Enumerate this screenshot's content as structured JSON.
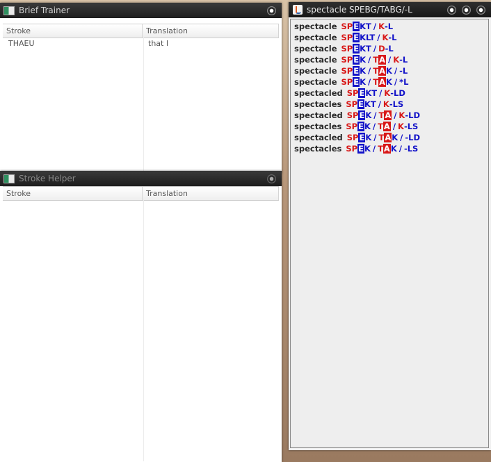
{
  "brief_trainer": {
    "title": "Brief Trainer",
    "columns": [
      "Stroke",
      "Translation"
    ],
    "rows": [
      {
        "stroke": "THAEU",
        "translation": "that I"
      }
    ]
  },
  "stroke_helper": {
    "title": "Stroke Helper",
    "columns": [
      "Stroke",
      "Translation"
    ],
    "rows": []
  },
  "spectacle_window": {
    "title": "spectacle  SPEBG/TABG/-L",
    "lines": [
      {
        "word": "spectacle",
        "segments": [
          [
            "red",
            "SP"
          ],
          [
            "hl-blue",
            "E"
          ],
          [
            "blue",
            "KT"
          ],
          [
            "sep",
            "/"
          ],
          [
            "red",
            "K"
          ],
          [
            "blue",
            "-L"
          ]
        ]
      },
      {
        "word": "spectacle",
        "segments": [
          [
            "red",
            "SP"
          ],
          [
            "hl-blue",
            "E"
          ],
          [
            "blue",
            "KLT"
          ],
          [
            "sep",
            "/"
          ],
          [
            "red",
            "K"
          ],
          [
            "blue",
            "-L"
          ]
        ]
      },
      {
        "word": "spectacle",
        "segments": [
          [
            "red",
            "SP"
          ],
          [
            "hl-blue",
            "E"
          ],
          [
            "blue",
            "KT"
          ],
          [
            "sep",
            "/"
          ],
          [
            "red",
            "D"
          ],
          [
            "blue",
            "-L"
          ]
        ]
      },
      {
        "word": "spectacle",
        "segments": [
          [
            "red",
            "SP"
          ],
          [
            "hl-blue",
            "E"
          ],
          [
            "blue",
            "K"
          ],
          [
            "sep",
            "/"
          ],
          [
            "red",
            "T"
          ],
          [
            "hl-red",
            "A"
          ],
          [
            "sep",
            "/"
          ],
          [
            "red",
            "K"
          ],
          [
            "blue",
            "-L"
          ]
        ]
      },
      {
        "word": "spectacle",
        "segments": [
          [
            "red",
            "SP"
          ],
          [
            "hl-blue",
            "E"
          ],
          [
            "blue",
            "K"
          ],
          [
            "sep",
            "/"
          ],
          [
            "red",
            "T"
          ],
          [
            "hl-red",
            "A"
          ],
          [
            "blue",
            "K"
          ],
          [
            "sep",
            "/"
          ],
          [
            "blue",
            "-L"
          ]
        ]
      },
      {
        "word": "spectacle",
        "segments": [
          [
            "red",
            "SP"
          ],
          [
            "hl-blue",
            "E"
          ],
          [
            "blue",
            "K"
          ],
          [
            "sep",
            "/"
          ],
          [
            "red",
            "T"
          ],
          [
            "hl-red",
            "A"
          ],
          [
            "blue",
            "K"
          ],
          [
            "sep",
            "/"
          ],
          [
            "blue",
            "*L"
          ]
        ]
      },
      {
        "word": "spectacled",
        "segments": [
          [
            "red",
            "SP"
          ],
          [
            "hl-blue",
            "E"
          ],
          [
            "blue",
            "KT"
          ],
          [
            "sep",
            "/"
          ],
          [
            "red",
            "K"
          ],
          [
            "blue",
            "-LD"
          ]
        ]
      },
      {
        "word": "spectacles",
        "segments": [
          [
            "red",
            "SP"
          ],
          [
            "hl-blue",
            "E"
          ],
          [
            "blue",
            "KT"
          ],
          [
            "sep",
            "/"
          ],
          [
            "red",
            "K"
          ],
          [
            "blue",
            "-LS"
          ]
        ]
      },
      {
        "word": "spectacled",
        "segments": [
          [
            "red",
            "SP"
          ],
          [
            "hl-blue",
            "E"
          ],
          [
            "blue",
            "K"
          ],
          [
            "sep",
            "/"
          ],
          [
            "red",
            "T"
          ],
          [
            "hl-red",
            "A"
          ],
          [
            "sep",
            "/"
          ],
          [
            "red",
            "K"
          ],
          [
            "blue",
            "-LD"
          ]
        ]
      },
      {
        "word": "spectacles",
        "segments": [
          [
            "red",
            "SP"
          ],
          [
            "hl-blue",
            "E"
          ],
          [
            "blue",
            "K"
          ],
          [
            "sep",
            "/"
          ],
          [
            "red",
            "T"
          ],
          [
            "hl-red",
            "A"
          ],
          [
            "sep",
            "/"
          ],
          [
            "red",
            "K"
          ],
          [
            "blue",
            "-LS"
          ]
        ]
      },
      {
        "word": "spectacled",
        "segments": [
          [
            "red",
            "SP"
          ],
          [
            "hl-blue",
            "E"
          ],
          [
            "blue",
            "K"
          ],
          [
            "sep",
            "/"
          ],
          [
            "red",
            "T"
          ],
          [
            "hl-red",
            "A"
          ],
          [
            "blue",
            "K"
          ],
          [
            "sep",
            "/"
          ],
          [
            "blue",
            "-LD"
          ]
        ]
      },
      {
        "word": "spectacles",
        "segments": [
          [
            "red",
            "SP"
          ],
          [
            "hl-blue",
            "E"
          ],
          [
            "blue",
            "K"
          ],
          [
            "sep",
            "/"
          ],
          [
            "red",
            "T"
          ],
          [
            "hl-red",
            "A"
          ],
          [
            "blue",
            "K"
          ],
          [
            "sep",
            "/"
          ],
          [
            "blue",
            "-LS"
          ]
        ]
      }
    ]
  },
  "colors": {
    "steno_red": "#d81818",
    "steno_blue": "#1111c8"
  }
}
